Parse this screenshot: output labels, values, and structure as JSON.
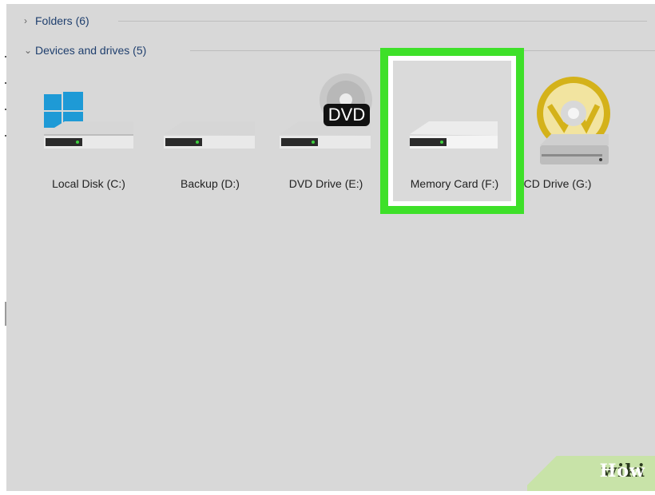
{
  "explorer": {
    "groups": [
      {
        "title": "Folders (6)",
        "expanded": false,
        "chevron_icon": "chevron-right-icon"
      },
      {
        "title": "Devices and drives (5)",
        "expanded": true,
        "chevron_icon": "chevron-down-icon"
      }
    ],
    "drives": [
      {
        "label": "Local Disk (C:)",
        "icon": "windows-hard-drive-icon"
      },
      {
        "label": "Backup (D:)",
        "icon": "hard-drive-icon"
      },
      {
        "label": "DVD Drive (E:)",
        "icon": "dvd-drive-icon",
        "badge": "DVD"
      },
      {
        "label": "Memory Card (F:)",
        "icon": "memory-card-drive-icon",
        "selected": true,
        "highlight_color": "#3ee029"
      },
      {
        "label": "CD Drive (G:)",
        "icon": "cd-drive-icon"
      }
    ]
  },
  "watermark": {
    "part1": "wiki",
    "part2": "How"
  }
}
